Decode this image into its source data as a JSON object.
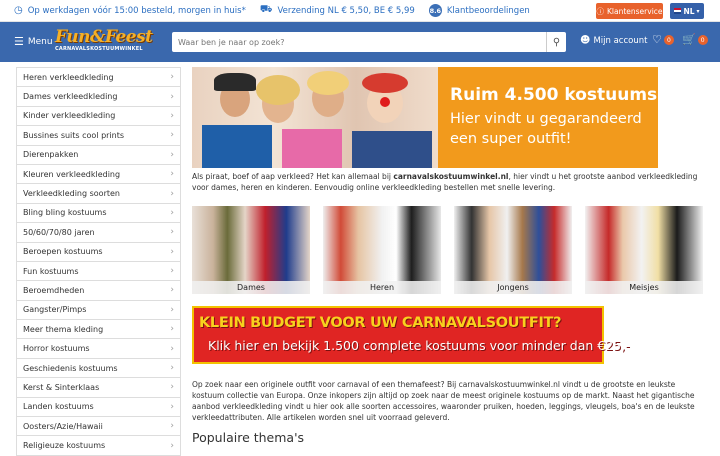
{
  "topbar": {
    "usp1": "Op werkdagen vóór 15:00 besteld, morgen in huis*",
    "usp2": "Verzending NL € 5,50, BE € 5,99",
    "score": "8.6",
    "reviews": "Klantbeoordelingen",
    "service": "Klantenservice",
    "lang": "NL"
  },
  "header": {
    "menu_label": "Menu",
    "logo_line1": "Fun&Feest",
    "logo_line2": "CARNAVALSKOSTUUMWINKEL",
    "search_placeholder": "Waar ben je naar op zoek?",
    "account_label": "Mijn account",
    "wishlist_count": "0",
    "cart_count": "0"
  },
  "sidebar": {
    "items": [
      {
        "label": "Heren verkleedkleding"
      },
      {
        "label": "Dames verkleedkleding"
      },
      {
        "label": "Kinder verkleedkleding"
      },
      {
        "label": "Bussines suits cool prints"
      },
      {
        "label": "Dierenpakken"
      },
      {
        "label": "Kleuren verkleedkleding"
      },
      {
        "label": "Verkleedkleding soorten"
      },
      {
        "label": "Bling bling kostuums"
      },
      {
        "label": "50/60/70/80 jaren"
      },
      {
        "label": "Beroepen kostuums"
      },
      {
        "label": "Fun kostuums"
      },
      {
        "label": "Beroemdheden"
      },
      {
        "label": "Gangster/Pimps"
      },
      {
        "label": "Meer thema kleding"
      },
      {
        "label": "Horror kostuums"
      },
      {
        "label": "Geschiedenis kostuums"
      },
      {
        "label": "Kerst & Sinterklaas"
      },
      {
        "label": "Landen kostuums"
      },
      {
        "label": "Oosters/Azie/Hawaii"
      },
      {
        "label": "Religieuze kostuums"
      }
    ]
  },
  "hero": {
    "title": "Ruim 4.500 kostuums",
    "subtitle": "Hier vindt u gegarandeerd een super outfit!"
  },
  "intro": {
    "part1": "Als piraat, boef of aap verkleed? Het kan allemaal bij ",
    "brand": "carnavalskostuumwinkel.nl",
    "part2": ", hier vindt u het grootste aanbod verkleedkleding voor dames, heren en kinderen. Eenvoudig online verkleedkleding bestellen met snelle levering."
  },
  "categories": [
    {
      "label": "Dames"
    },
    {
      "label": "Heren"
    },
    {
      "label": "Jongens"
    },
    {
      "label": "Meisjes"
    }
  ],
  "budget": {
    "line1": "KLEIN BUDGET VOOR UW CARNAVALSOUTFIT?",
    "line2": "Klik hier en bekijk 1.500 complete kostuums voor minder dan €25,-"
  },
  "body_text": "Op zoek naar een originele outfit voor carnaval of een themafeest? Bij carnavalskostuumwinkel.nl vindt u de grootste en leukste kostuum collectie van Europa. Onze inkopers zijn altijd op zoek naar de meest originele kostuums op de markt. Naast het gigantische aanbod verkleedkleding vindt u hier ook alle soorten accessoires, waaronder pruiken, hoeden, leggings, vleugels, boa's en de leukste verkleedattributen. Alle artikelen worden snel uit voorraad geleverd.",
  "section_title": "Populaire thema's",
  "colors": {
    "brand_blue": "#3a68ad",
    "accent_orange": "#e8622c",
    "hero_orange": "#f29a1c",
    "budget_red": "#e02523",
    "budget_yellow": "#f8d11d"
  }
}
